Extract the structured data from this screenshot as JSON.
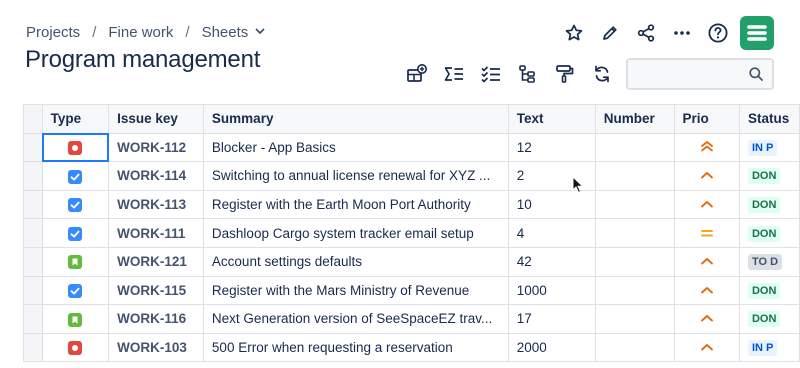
{
  "breadcrumb": {
    "projects": "Projects",
    "space": "Fine work",
    "current": "Sheets"
  },
  "page": {
    "title": "Program management"
  },
  "search": {
    "placeholder": ""
  },
  "columns": [
    "Type",
    "Issue key",
    "Summary",
    "Text",
    "Number",
    "Prio",
    "Status"
  ],
  "rows": [
    {
      "type": "bug",
      "key": "WORK-112",
      "summary": "Blocker - App Basics",
      "text": "12",
      "number": "",
      "prio": "highest",
      "status": "IN P",
      "status_kind": "inprog"
    },
    {
      "type": "task",
      "key": "WORK-114",
      "summary": "Switching to annual license renewal for XYZ ...",
      "text": "2",
      "number": "",
      "prio": "high",
      "status": "DON",
      "status_kind": "done"
    },
    {
      "type": "task",
      "key": "WORK-113",
      "summary": "Register with the Earth Moon Port Authority",
      "text": "10",
      "number": "",
      "prio": "high",
      "status": "DON",
      "status_kind": "done"
    },
    {
      "type": "task",
      "key": "WORK-111",
      "summary": "Dashloop Cargo system tracker email setup",
      "text": "4",
      "number": "",
      "prio": "medium",
      "status": "DON",
      "status_kind": "done"
    },
    {
      "type": "story",
      "key": "WORK-121",
      "summary": "Account settings defaults",
      "text": "42",
      "number": "",
      "prio": "high",
      "status": "TO D",
      "status_kind": "todo"
    },
    {
      "type": "task",
      "key": "WORK-115",
      "summary": "Register with the Mars Ministry of Revenue",
      "text": "1000",
      "number": "",
      "prio": "high",
      "status": "DON",
      "status_kind": "done"
    },
    {
      "type": "story",
      "key": "WORK-116",
      "summary": "Next Generation version of SeeSpaceEZ trav...",
      "text": "17",
      "number": "",
      "prio": "high",
      "status": "DON",
      "status_kind": "done"
    },
    {
      "type": "bug",
      "key": "WORK-103",
      "summary": "500 Error when requesting a reservation",
      "text": "2000",
      "number": "",
      "prio": "high",
      "status": "IN P",
      "status_kind": "inprog"
    }
  ],
  "icons": {
    "top_actions": [
      "star-icon",
      "pencil-icon",
      "share-icon",
      "more-icon",
      "help-icon"
    ],
    "toolbar": [
      "add-view-icon",
      "sum-icon",
      "checklist-icon",
      "hierarchy-icon",
      "format-painter-icon",
      "refresh-icon"
    ]
  },
  "colors": {
    "accent": "#1d7afc",
    "app_logo": "#22a06b",
    "bug": "#e2483d",
    "task": "#388bff",
    "story": "#63ba3c",
    "prio_high": "#e56910",
    "prio_medium": "#f5a623"
  }
}
